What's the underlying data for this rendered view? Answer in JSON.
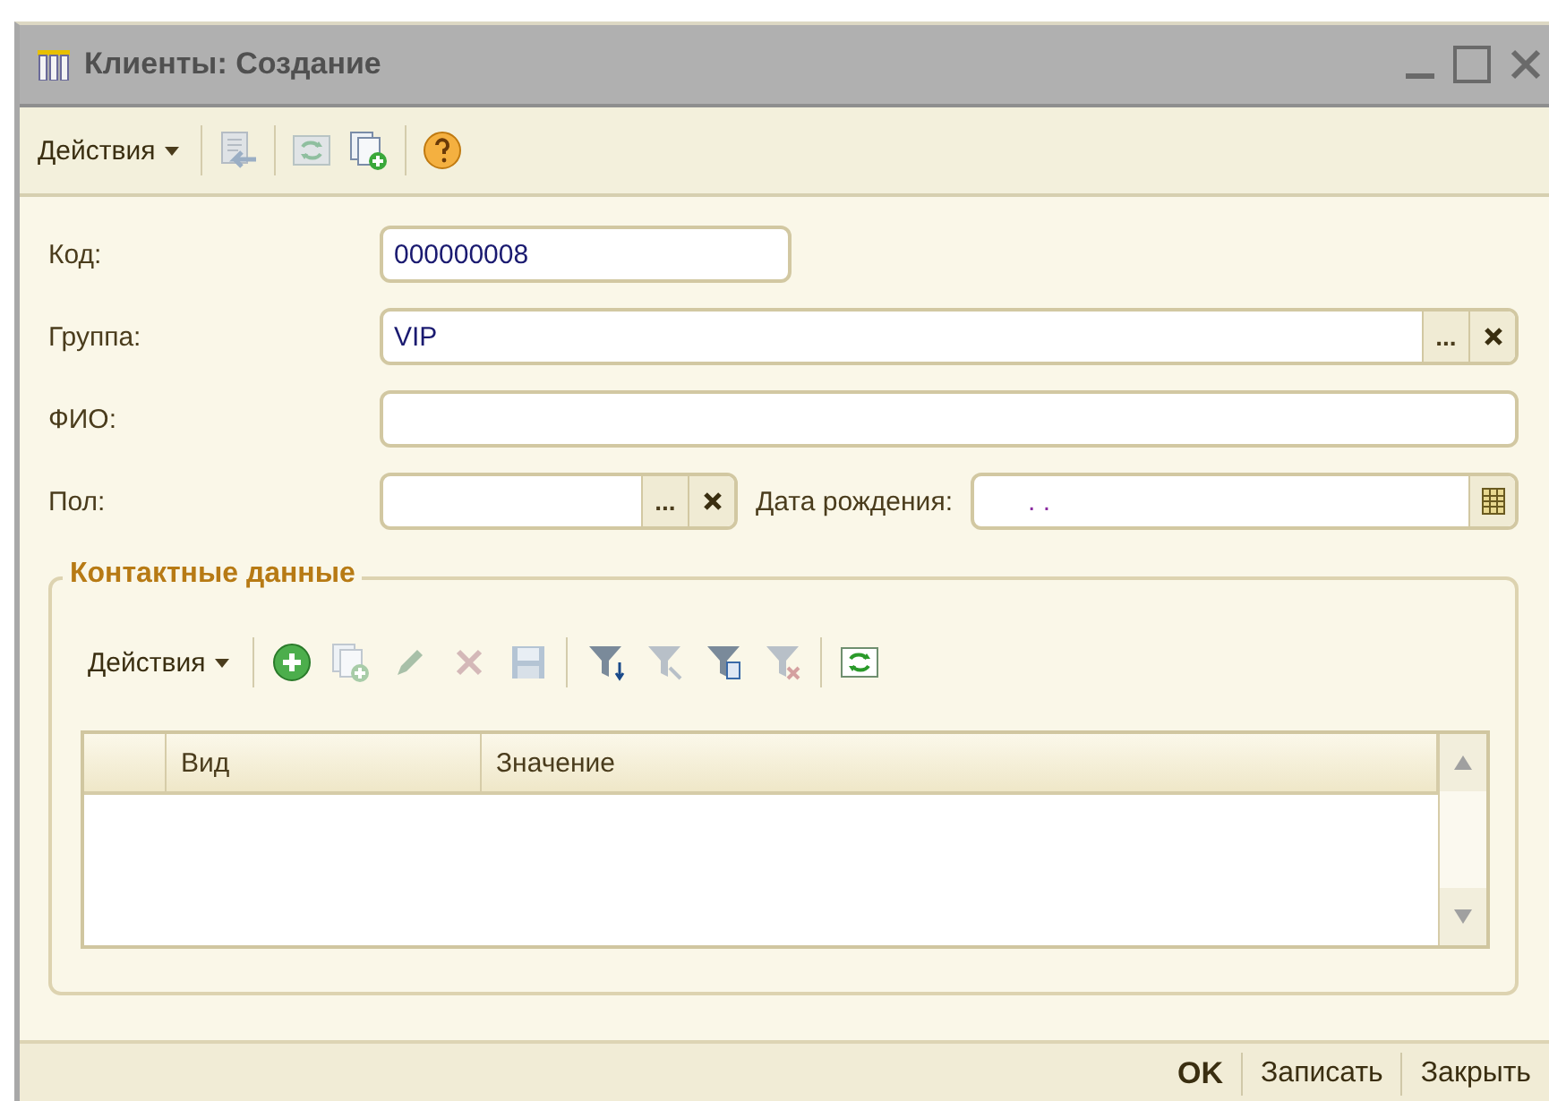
{
  "window": {
    "title": "Клиенты: Создание"
  },
  "toolbar": {
    "menu": "Действия",
    "buttons": [
      {
        "kind": "move",
        "disabled": true
      },
      {
        "kind": "separator"
      },
      {
        "kind": "refresh",
        "disabled": true
      },
      {
        "kind": "copy-add",
        "disabled": false
      },
      {
        "kind": "separator"
      },
      {
        "kind": "help",
        "disabled": false
      }
    ]
  },
  "form": {
    "code": {
      "label": "Код:",
      "value": "000000008"
    },
    "group": {
      "label": "Группа:",
      "value": "VIP",
      "choose_button": "..."
    },
    "full_name": {
      "label": "ФИО:"
    },
    "gender": {
      "label": "Пол:",
      "choose_button": "..."
    },
    "birth_date": {
      "label": "Дата рождения:",
      "value": ". ."
    }
  },
  "contacts": {
    "title": "Контактные данные",
    "menu": "Действия",
    "buttons": [
      {
        "kind": "add",
        "disabled": false
      },
      {
        "kind": "copy",
        "disabled": true
      },
      {
        "kind": "edit",
        "disabled": true
      },
      {
        "kind": "delete",
        "disabled": true
      },
      {
        "kind": "save",
        "disabled": true
      },
      {
        "kind": "separator"
      },
      {
        "kind": "filter-list",
        "disabled": false
      },
      {
        "kind": "filter",
        "disabled": true
      },
      {
        "kind": "filter-menu",
        "disabled": false
      },
      {
        "kind": "filter-clear",
        "disabled": true
      },
      {
        "kind": "separator"
      },
      {
        "kind": "refresh",
        "disabled": false
      }
    ],
    "table": {
      "columns": [
        {
          "label": "Вид"
        },
        {
          "label": "Значение"
        }
      ]
    }
  },
  "footer": {
    "buttons": [
      {
        "label": "OK",
        "default": true
      },
      {
        "label": "Записать",
        "default": false
      },
      {
        "label": "Закрыть",
        "default": false
      }
    ]
  }
}
